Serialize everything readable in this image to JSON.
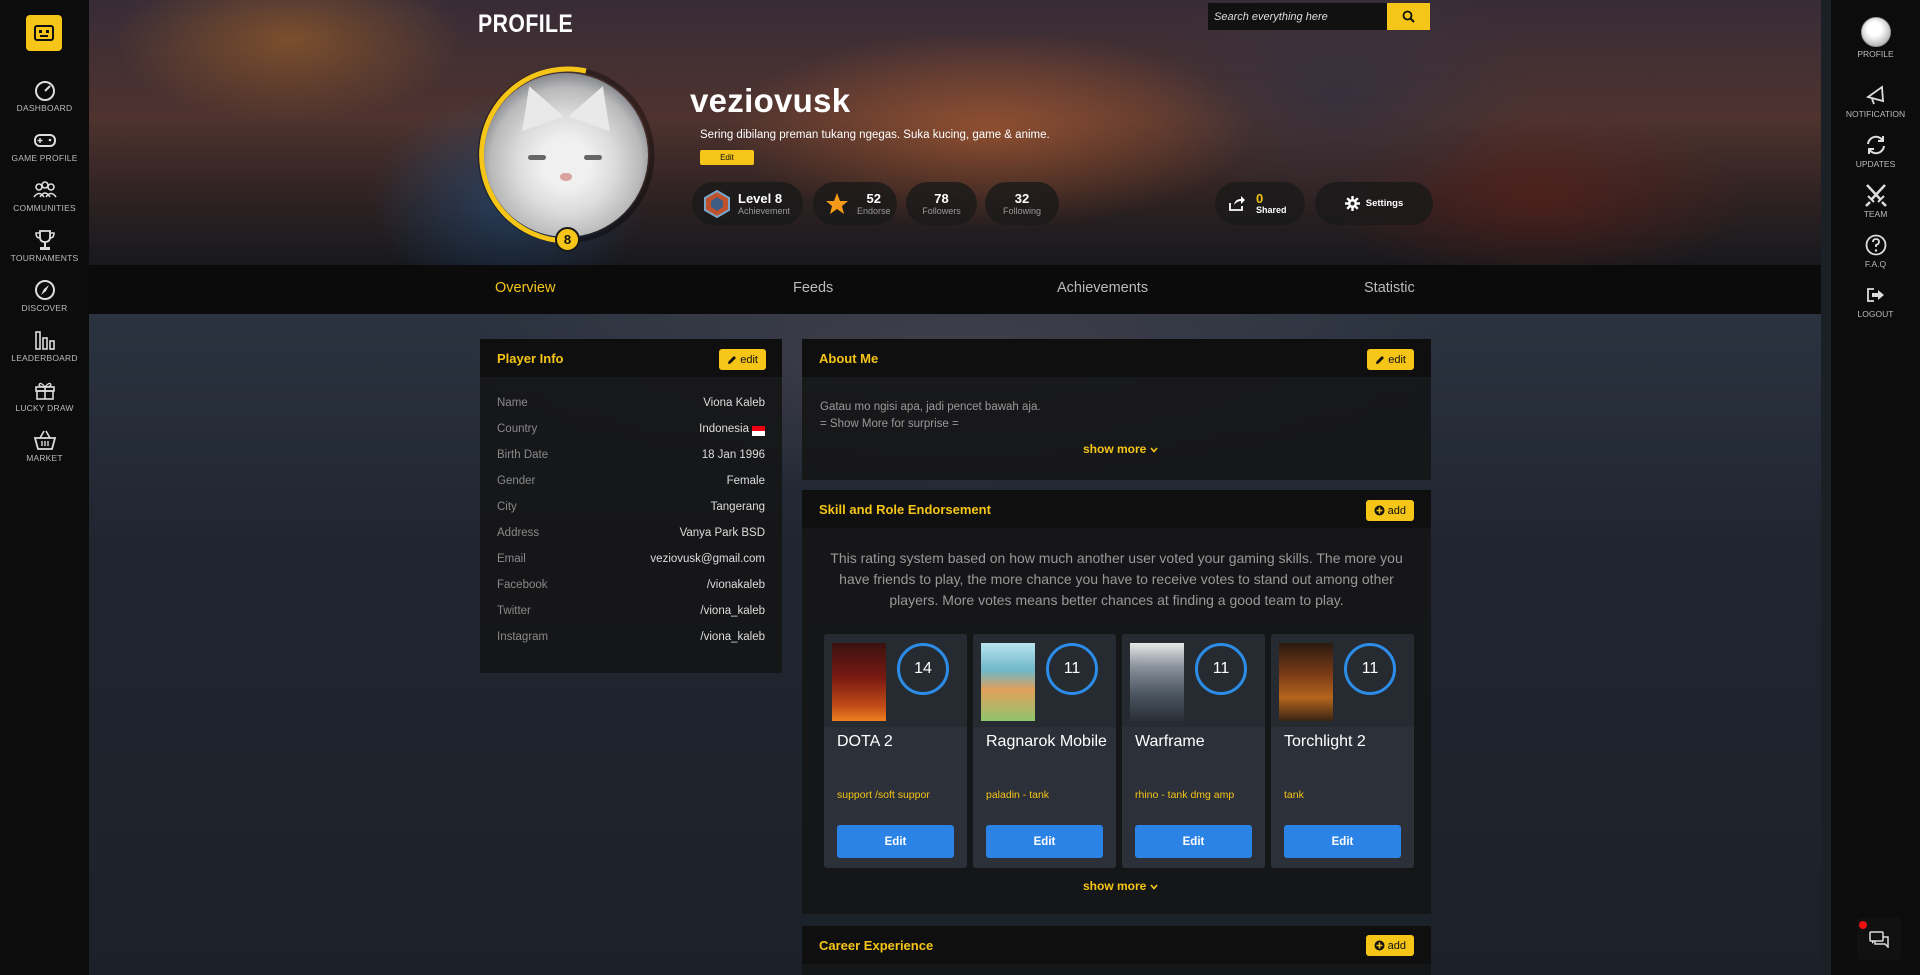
{
  "left_nav": [
    {
      "label": "DASHBOARD",
      "icon": "gauge-icon"
    },
    {
      "label": "GAME PROFILE",
      "icon": "gamepad-icon"
    },
    {
      "label": "COMMUNITIES",
      "icon": "users-icon"
    },
    {
      "label": "TOURNAMENTS",
      "icon": "trophy-icon"
    },
    {
      "label": "DISCOVER",
      "icon": "compass-icon"
    },
    {
      "label": "LEADERBOARD",
      "icon": "bars-icon"
    },
    {
      "label": "LUCKY DRAW",
      "icon": "gift-icon"
    },
    {
      "label": "MARKET",
      "icon": "basket-icon"
    }
  ],
  "right_nav": [
    {
      "label": "PROFILE",
      "icon": "avatar-icon"
    },
    {
      "label": "NOTIFICATION",
      "icon": "bell-icon"
    },
    {
      "label": "UPDATES",
      "icon": "refresh-icon"
    },
    {
      "label": "TEAM",
      "icon": "swords-icon"
    },
    {
      "label": "F.A.Q",
      "icon": "question-icon"
    },
    {
      "label": "LOGOUT",
      "icon": "logout-icon"
    }
  ],
  "header": {
    "title": "PROFILE",
    "search_placeholder": "Search everything here"
  },
  "profile": {
    "username": "veziovusk",
    "bio": "Sering dibilang preman tukang ngegas. Suka kucing, game & anime.",
    "bio_edit": "Edit",
    "level_badge": "8",
    "stats": {
      "level": "Level 8",
      "level_sub": "Achievement",
      "endorse": "52",
      "endorse_sub": "Endorse",
      "followers": "78",
      "followers_sub": "Followers",
      "following": "32",
      "following_sub": "Following",
      "shared": "0",
      "shared_sub": "Shared",
      "settings": "Settings"
    }
  },
  "tabs": [
    "Overview",
    "Feeds",
    "Achievements",
    "Statistic"
  ],
  "player_info": {
    "title": "Player Info",
    "edit": "edit",
    "rows": [
      {
        "label": "Name",
        "value": "Viona Kaleb"
      },
      {
        "label": "Country",
        "value": "Indonesia"
      },
      {
        "label": "Birth Date",
        "value": "18 Jan 1996"
      },
      {
        "label": "Gender",
        "value": "Female"
      },
      {
        "label": "City",
        "value": "Tangerang"
      },
      {
        "label": "Address",
        "value": "Vanya Park BSD"
      },
      {
        "label": "Email",
        "value": "veziovusk@gmail.com"
      },
      {
        "label": "Facebook",
        "value": "/vionakaleb"
      },
      {
        "label": "Twitter",
        "value": "/viona_kaleb"
      },
      {
        "label": "Instagram",
        "value": "/viona_kaleb"
      }
    ]
  },
  "about": {
    "title": "About Me",
    "edit": "edit",
    "line1": "Gatau mo ngisi apa, jadi pencet bawah aja.",
    "line2": "= Show More for surprise =",
    "show_more": "show more"
  },
  "endorsement": {
    "title": "Skill and Role Endorsement",
    "add": "add",
    "description": "This rating system based on how much another user voted your gaming skills. The more you have friends to play, the more chance you have to receive votes to stand out among other players. More votes means better chances at finding a good team to play.",
    "show_more": "show more",
    "games": [
      {
        "name": "DOTA 2",
        "score": "14",
        "role": "support /soft suppor",
        "edit": "Edit",
        "thumb_color": "#7a1a12"
      },
      {
        "name": "Ragnarok Mobile",
        "score": "11",
        "role": "paladin - tank",
        "edit": "Edit",
        "thumb_color": "#6fb7c9"
      },
      {
        "name": "Warframe",
        "score": "11",
        "role": "rhino - tank dmg amp",
        "edit": "Edit",
        "thumb_color": "#4c5661"
      },
      {
        "name": "Torchlight 2",
        "score": "11",
        "role": "tank",
        "edit": "Edit",
        "thumb_color": "#7a3b17"
      }
    ]
  },
  "career": {
    "title": "Career Experience",
    "add": "add"
  },
  "colors": {
    "accent": "#f5c518",
    "blue": "#2c83e6",
    "bg": "#1b1f26"
  }
}
